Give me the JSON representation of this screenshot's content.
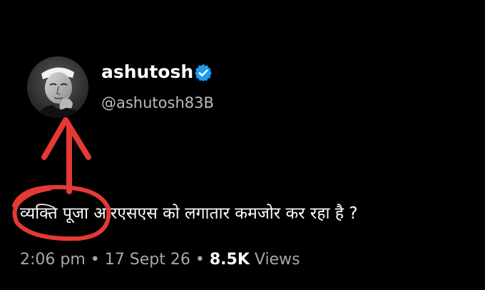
{
  "tweet": {
    "display_name": "ashutosh",
    "handle": "@ashutosh83B",
    "verified": true,
    "verified_color": "#1d9bf0",
    "text_highlight": "व्यक्ति पूजा",
    "text_rest": " आरएसएस को लगातार कमजोर कर रहा है ?",
    "time": "2:06 pm",
    "separator": "•",
    "date": "17 Sept 26",
    "views_count": "8.5K",
    "views_label": "Views"
  },
  "annotation": {
    "color": "#e53935",
    "shapes": [
      "arrow",
      "circle"
    ]
  },
  "icons": {
    "avatar": "portrait-photo",
    "verified": "verified-badge-icon"
  }
}
